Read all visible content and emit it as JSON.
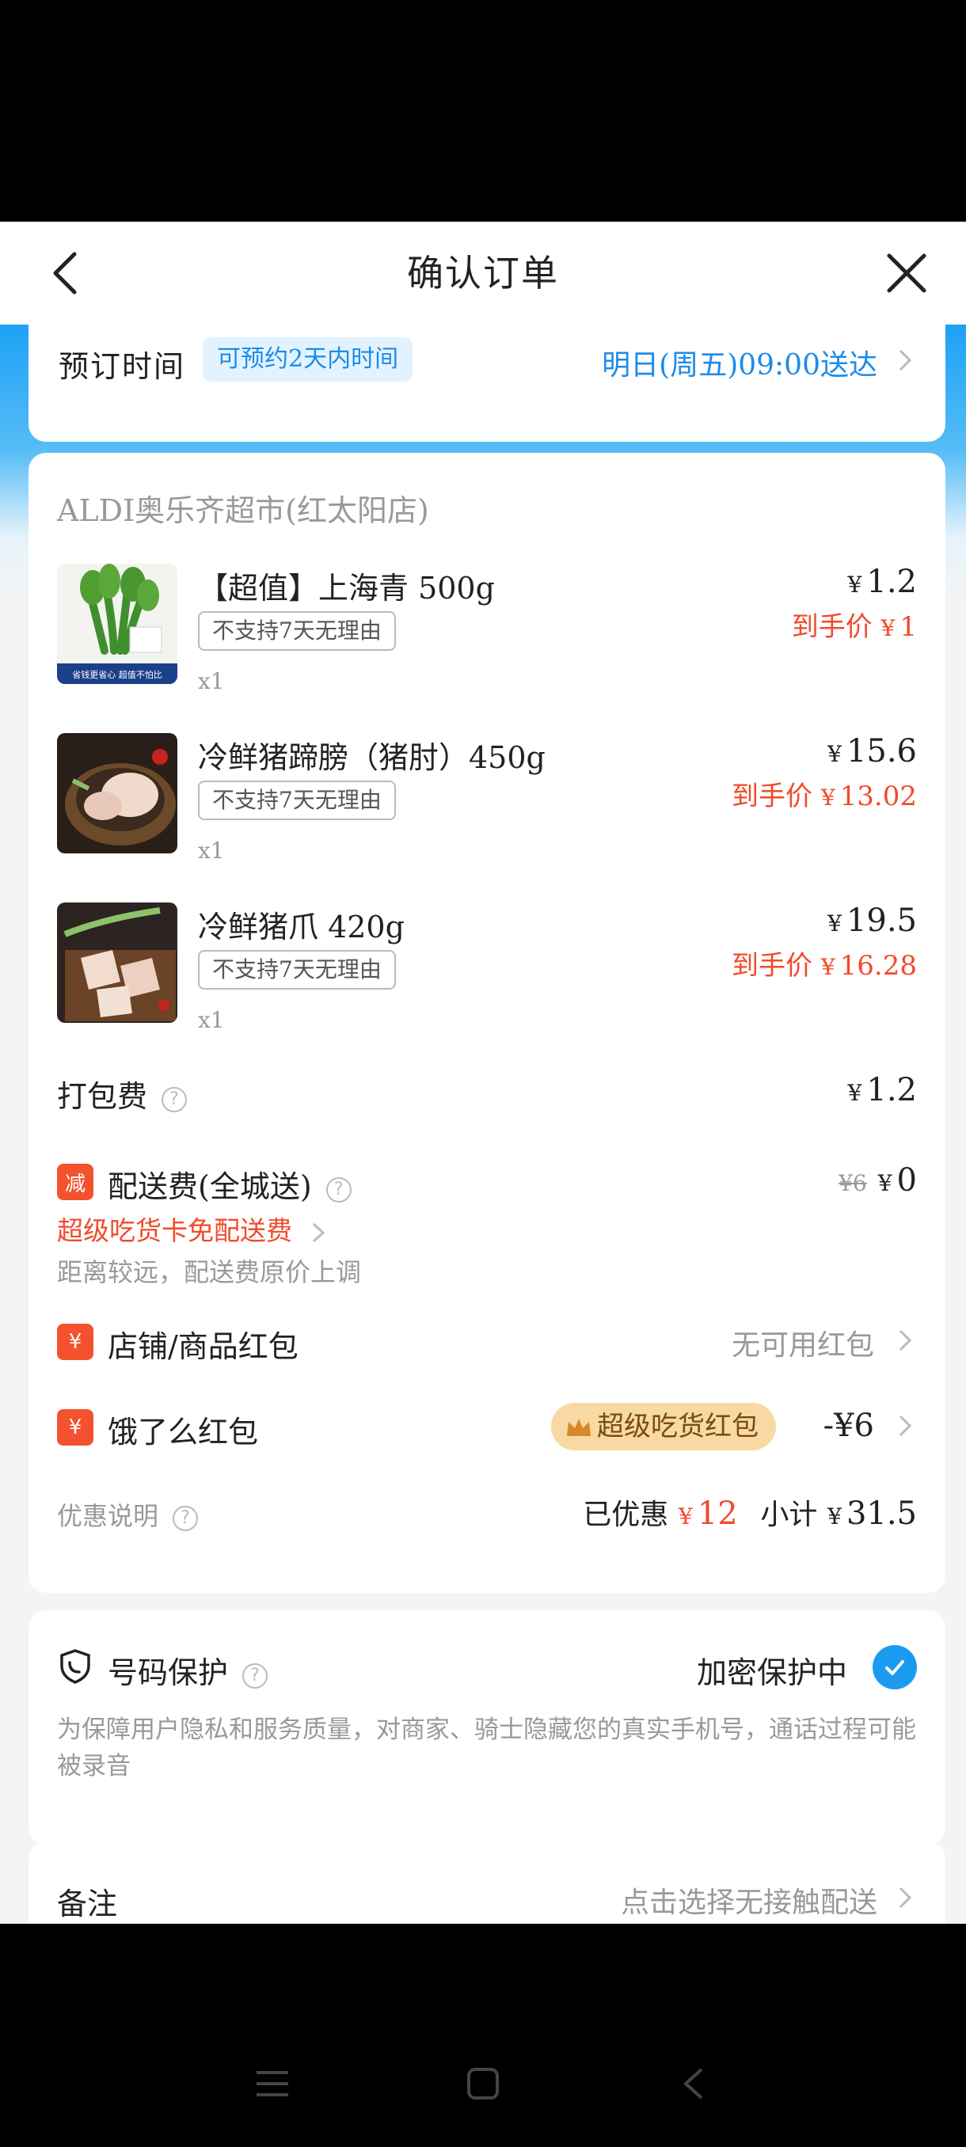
{
  "header": {
    "title": "确认订单"
  },
  "schedule": {
    "label": "预订时间",
    "badge": "可预约2天内时间",
    "value": "明日(周五)09:00送达"
  },
  "store": {
    "name": "ALDI奥乐齐超市(红太阳店)"
  },
  "items": [
    {
      "name": "【超值】上海青 500g",
      "tag": "不支持7天无理由",
      "qty": "x1",
      "price": "1.2",
      "final_label": "到手价",
      "final_price": "1",
      "thumb_caption": "省钱更省心 超值不怕比"
    },
    {
      "name": "冷鲜猪蹄膀（猪肘）450g",
      "tag": "不支持7天无理由",
      "qty": "x1",
      "price": "15.6",
      "final_label": "到手价",
      "final_price": "13.02"
    },
    {
      "name": "冷鲜猪爪 420g",
      "tag": "不支持7天无理由",
      "qty": "x1",
      "price": "19.5",
      "final_label": "到手价",
      "final_price": "16.28"
    }
  ],
  "currency": "¥",
  "packing": {
    "label": "打包费",
    "value": "1.2"
  },
  "delivery": {
    "badge": "减",
    "label": "配送费(全城送)",
    "original": "¥6",
    "value": "0",
    "promo": "超级吃货卡免配送费",
    "note": "距离较远，配送费原价上调"
  },
  "shop_coupon": {
    "badge": "¥",
    "label": "店铺/商品红包",
    "value": "无可用红包"
  },
  "ele_coupon": {
    "badge": "¥",
    "label": "饿了么红包",
    "tag": "超级吃货红包",
    "value": "-¥6"
  },
  "summary": {
    "label": "优惠说明",
    "saved_label": "已优惠",
    "saved": "12",
    "subtotal_label": "小计",
    "subtotal": "31.5"
  },
  "privacy": {
    "label": "号码保护",
    "status": "加密保护中",
    "desc": "为保障用户隐私和服务质量，对商家、骑士隐藏您的真实手机号，通话过程可能被录音"
  },
  "remark": {
    "label": "备注",
    "value": "点击选择无接触配送"
  },
  "colors": {
    "accent": "#1d8be8",
    "red": "#f24a2b",
    "check": "#1b9bf0"
  }
}
